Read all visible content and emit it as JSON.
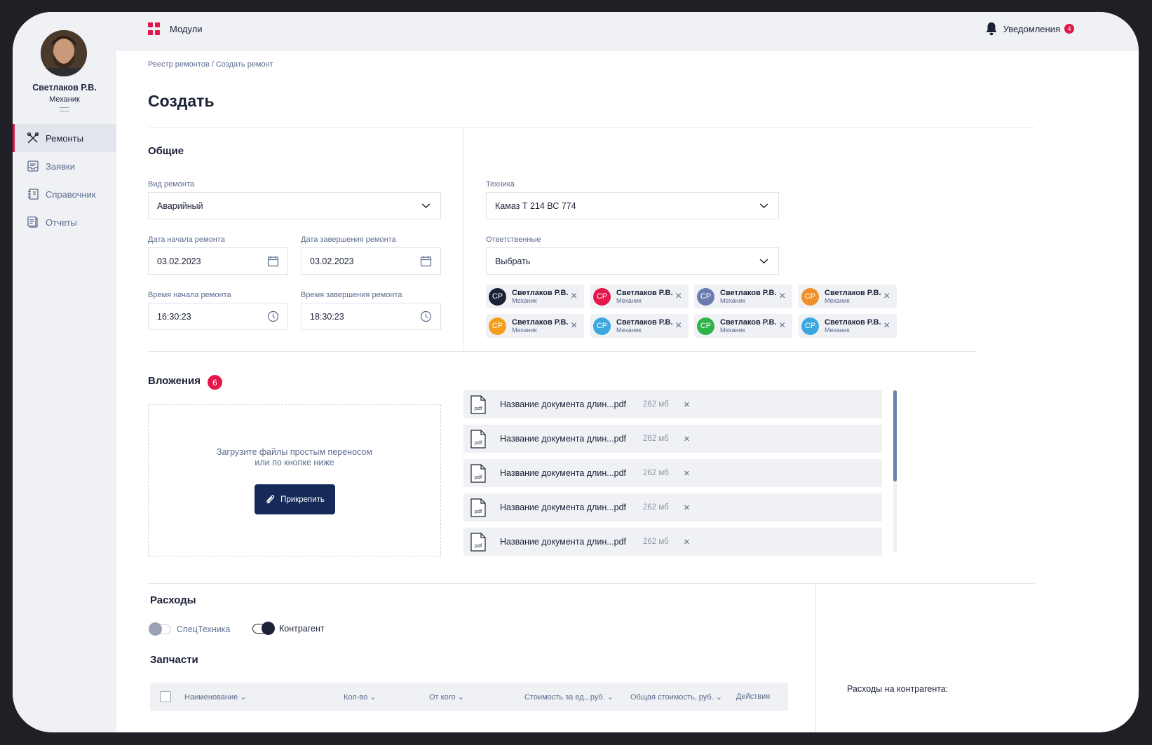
{
  "user": {
    "name": "Светлаков Р.В.",
    "role": "Механик"
  },
  "sidebar": {
    "items": [
      {
        "label": "Ремонты",
        "icon": "wrench-tools-icon",
        "active": true
      },
      {
        "label": "Заявки",
        "icon": "inbox-icon",
        "active": false
      },
      {
        "label": "Справочник",
        "icon": "book-icon",
        "active": false
      },
      {
        "label": "Отчеты",
        "icon": "report-icon",
        "active": false
      }
    ]
  },
  "topbar": {
    "modules_label": "Модули",
    "notifications_label": "Уведомления",
    "notifications_count": "4"
  },
  "breadcrumb": "Реестр ремонтов / Создать ремонт",
  "page_title": "Создать",
  "general": {
    "title": "Общие",
    "repair_type": {
      "label": "Вид ремонта",
      "value": "Аварийный"
    },
    "start_date": {
      "label": "Дата начала  ремонта",
      "value": "03.02.2023"
    },
    "end_date": {
      "label": "Дата завершения ремонта",
      "value": "03.02.2023"
    },
    "start_time": {
      "label": "Время начала  ремонта",
      "value": "16:30:23"
    },
    "end_time": {
      "label": "Время завершения ремонта",
      "value": "18:30:23"
    },
    "equipment": {
      "label": "Техника",
      "value": "Камаз Т 214 ВС 774"
    },
    "responsible": {
      "label": "Ответственные",
      "value": "Выбрать"
    }
  },
  "responsible_chips": [
    {
      "initials": "СР",
      "name": "Светлаков Р.В.",
      "role": "Механик",
      "color": "#1b2238"
    },
    {
      "initials": "СР",
      "name": "Светлаков Р.В.",
      "role": "Механик",
      "color": "#e3174a"
    },
    {
      "initials": "СР",
      "name": "Светлаков Р.В.",
      "role": "Механик",
      "color": "#6b7bb0"
    },
    {
      "initials": "СР",
      "name": "Светлаков Р.В.",
      "role": "Механик",
      "color": "#f0902c"
    },
    {
      "initials": "СР",
      "name": "Светлаков Р.В.",
      "role": "Механик",
      "color": "#f59e1b"
    },
    {
      "initials": "СР",
      "name": "Светлаков Р.В.",
      "role": "Механик",
      "color": "#3aa7e0"
    },
    {
      "initials": "СР",
      "name": "Светлаков Р.В.",
      "role": "Механик",
      "color": "#2db34a"
    },
    {
      "initials": "СР",
      "name": "Светлаков Р.В.",
      "role": "Механик",
      "color": "#3aa7e0"
    }
  ],
  "attachments": {
    "title": "Вложения",
    "count": "6",
    "dropzone_text": "Загрузите файлы простым переносом или по кнопке ниже",
    "attach_button": "Прикрепить",
    "files": [
      {
        "name": "Название документа длин...pdf",
        "size": "262 мб",
        "icon_text": "pdf"
      },
      {
        "name": "Название документа длин...pdf",
        "size": "262 мб",
        "icon_text": "pdf"
      },
      {
        "name": "Название документа длин...pdf",
        "size": "262 мб",
        "icon_text": "pdf"
      },
      {
        "name": "Название документа длин...pdf",
        "size": "262 мб",
        "icon_text": "pdf"
      },
      {
        "name": "Название документа длин...pdf",
        "size": "262 мб",
        "icon_text": "pdf"
      }
    ]
  },
  "expenses": {
    "title": "Расходы",
    "toggle_special": "СпецТехника",
    "toggle_contractor": "Контрагент",
    "parts_title": "Запчасти",
    "columns": [
      "Наименование",
      "Кол-во",
      "От кого",
      "Стоимость за ед., руб.",
      "Общая стоимость, руб.",
      "Действия"
    ],
    "contractor_expenses_label": "Расходы на контрагента:"
  },
  "colors": {
    "accent": "#e3174a",
    "primary": "#152a58",
    "text": "#1b2238",
    "muted": "#5b6b8e",
    "surface": "#eff1f5"
  }
}
